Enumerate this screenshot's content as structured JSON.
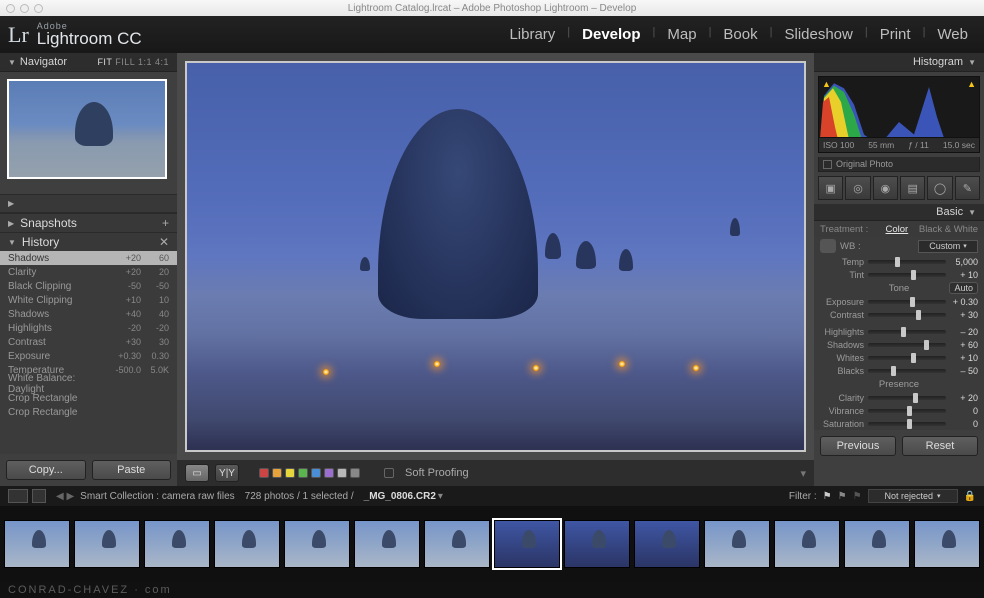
{
  "mac": {
    "title": "Lightroom Catalog.lrcat – Adobe Photoshop Lightroom – Develop"
  },
  "brand": {
    "small": "Adobe",
    "name": "Lightroom CC"
  },
  "modules": [
    "Library",
    "Develop",
    "Map",
    "Book",
    "Slideshow",
    "Print",
    "Web"
  ],
  "active_module": "Develop",
  "left": {
    "navigator": {
      "title": "Navigator",
      "opts": [
        "FIT",
        "FILL",
        "1:1",
        "4:1"
      ],
      "active": "FIT"
    },
    "snapshots": {
      "title": "Snapshots",
      "btn": "+"
    },
    "history": {
      "title": "History",
      "btn": "✕",
      "items": [
        {
          "name": "Shadows",
          "a": "+20",
          "b": "60",
          "sel": true
        },
        {
          "name": "Clarity",
          "a": "+20",
          "b": "20"
        },
        {
          "name": "Black Clipping",
          "a": "-50",
          "b": "-50"
        },
        {
          "name": "White Clipping",
          "a": "+10",
          "b": "10"
        },
        {
          "name": "Shadows",
          "a": "+40",
          "b": "40"
        },
        {
          "name": "Highlights",
          "a": "-20",
          "b": "-20"
        },
        {
          "name": "Contrast",
          "a": "+30",
          "b": "30"
        },
        {
          "name": "Exposure",
          "a": "+0.30",
          "b": "0.30"
        },
        {
          "name": "Temperature",
          "a": "-500.0",
          "b": "5.0K"
        },
        {
          "name": "White Balance: Daylight",
          "a": "",
          "b": ""
        },
        {
          "name": "Crop Rectangle",
          "a": "",
          "b": ""
        },
        {
          "name": "Crop Rectangle",
          "a": "",
          "b": ""
        }
      ]
    },
    "copy": "Copy...",
    "paste": "Paste"
  },
  "center": {
    "soft_proofing": "Soft Proofing",
    "swatches": [
      "#c44",
      "#e7a23c",
      "#e7d53c",
      "#5ab54f",
      "#4a8fd6",
      "#9a6fd0",
      "#b9b9b9",
      "#888"
    ]
  },
  "right": {
    "histogram": {
      "title": "Histogram",
      "iso": "ISO 100",
      "focal": "55 mm",
      "aperture": "ƒ / 11",
      "shutter": "15.0 sec",
      "original": "Original Photo"
    },
    "basic": "Basic",
    "treatment": {
      "label": "Treatment :",
      "color": "Color",
      "bw": "Black & White"
    },
    "wb": {
      "label": "WB :",
      "mode": "Custom"
    },
    "sliders": {
      "wb": [
        {
          "name": "Temp",
          "val": "5,000",
          "pos": 35
        },
        {
          "name": "Tint",
          "val": "+ 10",
          "pos": 55
        }
      ],
      "tone_title": "Tone",
      "tone_auto": "Auto",
      "tone": [
        {
          "name": "Exposure",
          "val": "+ 0.30",
          "pos": 54
        },
        {
          "name": "Contrast",
          "val": "+ 30",
          "pos": 62
        }
      ],
      "tone2": [
        {
          "name": "Highlights",
          "val": "– 20",
          "pos": 42
        },
        {
          "name": "Shadows",
          "val": "+ 60",
          "pos": 72
        },
        {
          "name": "Whites",
          "val": "+ 10",
          "pos": 55
        },
        {
          "name": "Blacks",
          "val": "– 50",
          "pos": 30
        }
      ],
      "presence_title": "Presence",
      "presence": [
        {
          "name": "Clarity",
          "val": "+ 20",
          "pos": 58
        },
        {
          "name": "Vibrance",
          "val": "0",
          "pos": 50
        },
        {
          "name": "Saturation",
          "val": "0",
          "pos": 50
        }
      ]
    },
    "previous": "Previous",
    "reset": "Reset"
  },
  "infobar": {
    "collection": "Smart Collection : camera raw files",
    "count": "728 photos / 1 selected /",
    "file": "_MG_0806.CR2",
    "filter": "Filter :",
    "rejected": "Not rejected"
  },
  "footer": "CONRAD-CHAVEZ · com"
}
